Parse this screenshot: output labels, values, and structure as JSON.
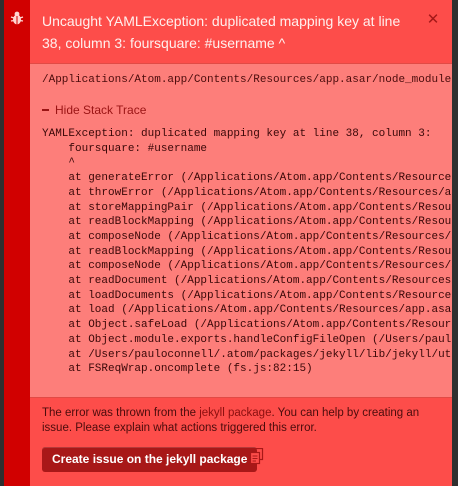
{
  "notification": {
    "title": "Uncaught YAMLException: duplicated mapping key at line 38, column 3: foursquare: #username ^",
    "path": "/Applications/Atom.app/Contents/Resources/app.asar/node_modules/yaml",
    "toggle_label": "Hide Stack Trace",
    "stack_trace": [
      "YAMLException: duplicated mapping key at line 38, column 3:",
      "    foursquare: #username",
      "    ^",
      "    at generateError (/Applications/Atom.app/Contents/Resources/app.",
      "    at throwError (/Applications/Atom.app/Contents/Resources/app.asa",
      "    at storeMappingPair (/Applications/Atom.app/Contents/Resources/a",
      "    at readBlockMapping (/Applications/Atom.app/Contents/Resources/a",
      "    at composeNode (/Applications/Atom.app/Contents/Resources/app.as",
      "    at readBlockMapping (/Applications/Atom.app/Contents/Resources/a",
      "    at composeNode (/Applications/Atom.app/Contents/Resources/app.as",
      "    at readDocument (/Applications/Atom.app/Contents/Resources/app.a",
      "    at loadDocuments (/Applications/Atom.app/Contents/Resources/app.",
      "    at load (/Applications/Atom.app/Contents/Resources/app.asar/node",
      "    at Object.safeLoad (/Applications/Atom.app/Contents/Resources/ap",
      "    at Object.module.exports.handleConfigFileOpen (/Users/paulocon",
      "    at /Users/pauloconnell/.atom/packages/jekyll/lib/jekyll/utils.",
      "    at FSReqWrap.oncomplete (fs.js:82:15)"
    ],
    "explain_before": "The error was thrown from the ",
    "explain_link": "jekyll package",
    "explain_after": ". You can help by creating an issue. Please explain what actions triggered this error.",
    "create_issue_label": "Create issue on the jekyll package",
    "icons": {
      "side": "bug-icon",
      "close": "close-icon",
      "copy": "copy-icon"
    },
    "colors": {
      "side_bar": "#d10000",
      "header": "#fd4d4a",
      "detail": "#fd7e7a",
      "button": "#a81818"
    }
  }
}
